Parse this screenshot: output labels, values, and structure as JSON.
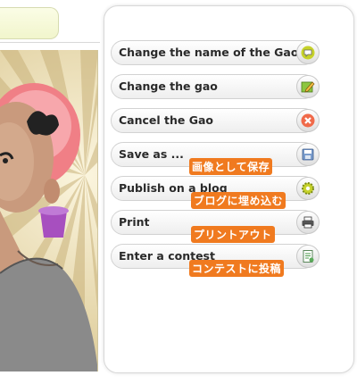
{
  "menu": {
    "items": [
      {
        "label": "Change the name of the Gao",
        "icon": "speech-bubble-icon",
        "icon_color": "#b8c41a"
      },
      {
        "label": "Change the gao",
        "icon": "edit-pencil-icon",
        "icon_color": "#7ab82a"
      },
      {
        "label": "Cancel the Gao",
        "icon": "cancel-x-icon",
        "icon_color": "#f07a5a"
      },
      {
        "label": "Save as ...",
        "icon": "floppy-disk-icon",
        "icon_color": "#6a8fbf"
      },
      {
        "label": "Publish on a blog",
        "icon": "gear-icon",
        "icon_color": "#b8c41a"
      },
      {
        "label": "Print",
        "icon": "printer-icon",
        "icon_color": "#555555"
      },
      {
        "label": "Enter a contest",
        "icon": "document-icon",
        "icon_color": "#4a9a4a"
      }
    ]
  },
  "annotations": {
    "save": "画像として保存",
    "blog": "ブログに埋め込む",
    "print": "プリントアウト",
    "contest": "コンテストに投稿"
  },
  "colors": {
    "annotation_bg": "#f07a1f",
    "sunburst_light": "#f1e7c4",
    "sunburst_dark": "#c9b27a"
  }
}
